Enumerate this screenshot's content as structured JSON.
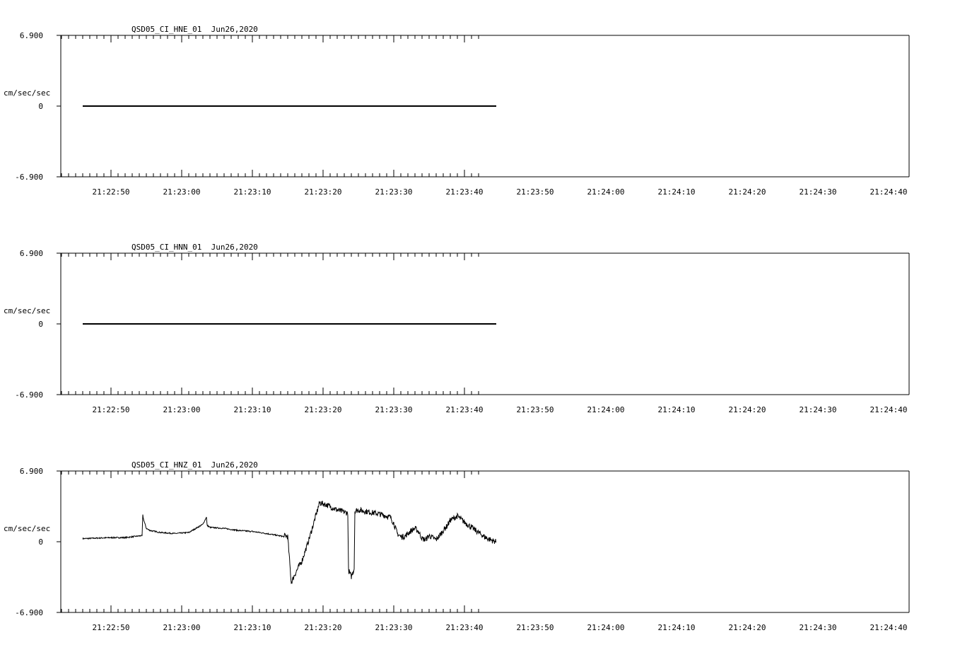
{
  "chart_data": [
    {
      "type": "line",
      "title": "QSD05_CI_HNE_01  Jun26,2020",
      "ylabel": "cm/sec/sec",
      "yticks": [
        "6.900",
        "0",
        "-6.900"
      ],
      "ylim": [
        -6.9,
        6.9
      ],
      "xticks": [
        "21:22:50",
        "21:23:00",
        "21:23:10",
        "21:23:20",
        "21:23:30",
        "21:23:40",
        "21:23:50",
        "21:24:00",
        "21:24:10",
        "21:24:20",
        "21:24:30",
        "21:24:40"
      ],
      "xlim_seconds_after_212250": [
        -5.0,
        55.0
      ],
      "grid": false,
      "series": [
        {
          "x": [
            -4.0,
            54.5
          ],
          "y": [
            0,
            0
          ]
        }
      ]
    },
    {
      "type": "line",
      "title": "QSD05_CI_HNN_01  Jun26,2020",
      "ylabel": "cm/sec/sec",
      "yticks": [
        "6.900",
        "0",
        "-6.900"
      ],
      "ylim": [
        -6.9,
        6.9
      ],
      "xticks": [
        "21:22:50",
        "21:23:00",
        "21:23:10",
        "21:23:20",
        "21:23:30",
        "21:23:40",
        "21:23:50",
        "21:24:00",
        "21:24:10",
        "21:24:20",
        "21:24:30",
        "21:24:40"
      ],
      "grid": false,
      "series": [
        {
          "x": [
            -4.0,
            54.5
          ],
          "y": [
            0,
            0
          ]
        }
      ]
    },
    {
      "type": "line",
      "title": "QSD05_CI_HNZ_01  Jun26,2020",
      "ylabel": "cm/sec/sec",
      "yticks": [
        "6.900",
        "0",
        "-6.900"
      ],
      "ylim": [
        -6.9,
        6.9
      ],
      "xticks": [
        "21:22:50",
        "21:23:00",
        "21:23:10",
        "21:23:20",
        "21:23:30",
        "21:23:40",
        "21:23:50",
        "21:24:00",
        "21:24:10",
        "21:24:20",
        "21:24:30",
        "21:24:40"
      ],
      "grid": false,
      "series": [
        {
          "x": [
            -4.0,
            0,
            2,
            4.4,
            4.5,
            4.6,
            5.0,
            5.5,
            7,
            9,
            11,
            13,
            13.5,
            13.6,
            14.0,
            16,
            18,
            20,
            22,
            24.5,
            24.6,
            25.0,
            25.5,
            26.0,
            26.5,
            27.0,
            28.0,
            29.0,
            29.5,
            30.5,
            32.0,
            33.5,
            33.6,
            34.0,
            34.4,
            34.5,
            35.0,
            36.5,
            38.0,
            39.5,
            40.0,
            40.5,
            41.0,
            41.5,
            42.0,
            42.5,
            43.0,
            43.5,
            44.0,
            44.5,
            45.0,
            45.5,
            46.0,
            46.5,
            47.0,
            47.5,
            48.0,
            49.0,
            50.0,
            51.0,
            52.0,
            53.0,
            54.0,
            54.5
          ],
          "y": [
            0.3,
            0.4,
            0.4,
            0.6,
            2.6,
            2.2,
            1.3,
            1.1,
            0.9,
            0.8,
            0.9,
            1.7,
            2.4,
            1.6,
            1.4,
            1.3,
            1.1,
            1.0,
            0.8,
            0.5,
            0.6,
            0.5,
            -4.0,
            -3.2,
            -2.5,
            -1.9,
            0.2,
            2.6,
            3.8,
            3.6,
            3.1,
            2.8,
            -2.8,
            -3.4,
            -2.6,
            3.0,
            3.1,
            2.9,
            2.7,
            2.4,
            1.8,
            0.8,
            0.5,
            0.5,
            0.8,
            1.1,
            1.3,
            1.0,
            0.3,
            0.2,
            0.6,
            0.4,
            0.2,
            0.6,
            1.1,
            1.5,
            2.1,
            2.5,
            1.9,
            1.4,
            0.9,
            0.4,
            0.1,
            0.0
          ]
        }
      ]
    }
  ]
}
